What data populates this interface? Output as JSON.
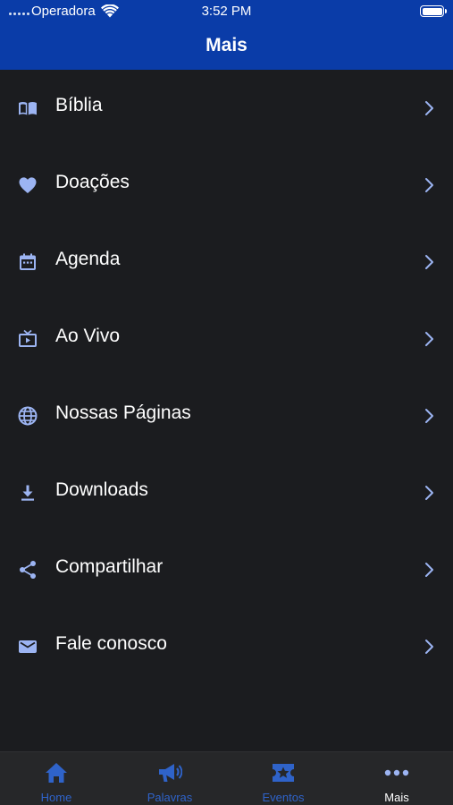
{
  "status_bar": {
    "carrier": "Operadora",
    "time": "3:52 PM"
  },
  "header": {
    "title": "Mais"
  },
  "menu": {
    "items": [
      {
        "label": "Bíblia",
        "icon": "book-icon"
      },
      {
        "label": "Doações",
        "icon": "heart-icon"
      },
      {
        "label": "Agenda",
        "icon": "calendar-icon"
      },
      {
        "label": "Ao Vivo",
        "icon": "live-tv-icon"
      },
      {
        "label": "Nossas Páginas",
        "icon": "globe-icon"
      },
      {
        "label": "Downloads",
        "icon": "download-icon"
      },
      {
        "label": "Compartilhar",
        "icon": "share-icon"
      },
      {
        "label": "Fale conosco",
        "icon": "mail-icon"
      }
    ]
  },
  "tab_bar": {
    "items": [
      {
        "label": "Home",
        "icon": "home-icon"
      },
      {
        "label": "Palavras",
        "icon": "megaphone-icon"
      },
      {
        "label": "Eventos",
        "icon": "ticket-star-icon"
      },
      {
        "label": "Mais",
        "icon": "more-dots-icon",
        "active": true
      }
    ]
  },
  "colors": {
    "header_bg": "#0a3ca8",
    "background": "#1b1c1f",
    "icon_accent": "#9cb4f2",
    "tab_accent": "#2f63c9"
  }
}
